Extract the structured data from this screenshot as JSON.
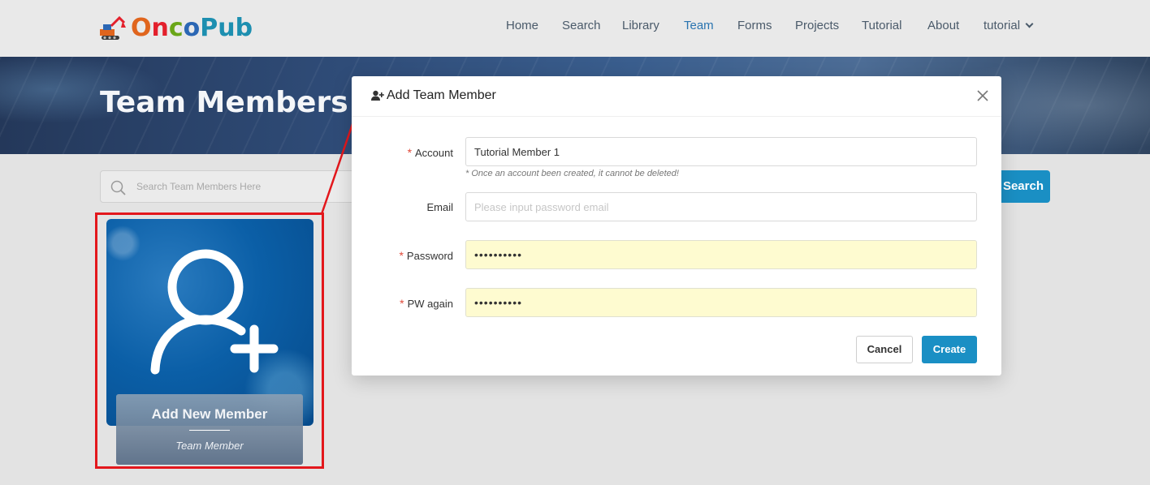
{
  "app": {
    "logo_text": {
      "o": "O",
      "n": "n",
      "c": "c",
      "o2": "o",
      "pub": "Pub"
    }
  },
  "nav": {
    "items": [
      {
        "label": "Home"
      },
      {
        "label": "Search"
      },
      {
        "label": "Library"
      },
      {
        "label": "Team"
      },
      {
        "label": "Forms"
      },
      {
        "label": "Projects"
      },
      {
        "label": "Tutorial"
      },
      {
        "label": "About"
      }
    ],
    "user_menu": "tutorial",
    "active": "Team"
  },
  "banner": {
    "title": "Team Members"
  },
  "search": {
    "placeholder": "Search Team Members Here",
    "button_label": "Search"
  },
  "member_card": {
    "name": "Add New Member",
    "role": "Team Member",
    "icon": "add-user-icon"
  },
  "modal": {
    "title": "Add Team Member",
    "title_icon": "user-plus-icon",
    "fields": {
      "account": {
        "label": "Account",
        "required": "*",
        "value": "Tutorial Member 1",
        "hint": "* Once an account been created, it cannot be deleted!"
      },
      "email": {
        "label": "Email",
        "value": "",
        "placeholder": "Please input password email"
      },
      "password": {
        "label": "Password",
        "required": "*",
        "value": "••••••••••"
      },
      "pw_again": {
        "label": "PW again",
        "required": "*",
        "value": "••••••••••"
      }
    },
    "cancel_label": "Cancel",
    "create_label": "Create"
  },
  "colors": {
    "accent": "#1a8fc4",
    "highlight": "#e3171c",
    "autofill": "#fefbd0",
    "nav_active": "#2a74b0"
  }
}
